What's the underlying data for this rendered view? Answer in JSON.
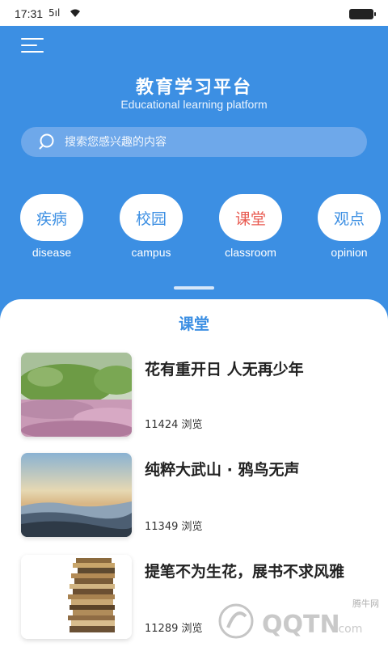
{
  "status_bar": {
    "time": "17:31",
    "signal": "5ıl",
    "icons": [
      "wifi-icon",
      "battery-icon"
    ]
  },
  "header": {
    "menu_icon": "hamburger-menu-icon",
    "title": "教育学习平台",
    "subtitle": "Educational learning platform"
  },
  "search": {
    "placeholder": "搜索您感兴趣的内容",
    "icon": "search-icon"
  },
  "categories": [
    {
      "label_cn": "疾病",
      "label_en": "disease",
      "active": false
    },
    {
      "label_cn": "校园",
      "label_en": "campus",
      "active": false
    },
    {
      "label_cn": "课堂",
      "label_en": "classroom",
      "active": true
    },
    {
      "label_cn": "观点",
      "label_en": "opinion",
      "active": false
    }
  ],
  "section": {
    "title": "课堂"
  },
  "articles": [
    {
      "title": "花有重开日 人无再少年",
      "views": "11424 浏览",
      "image": "flower-field-photo"
    },
    {
      "title": "纯粹大武山 · 鸦鸟无声",
      "views": "11349 浏览",
      "image": "mountain-sunset-photo"
    },
    {
      "title": "提笔不为生花，展书不求风雅",
      "views": "11289 浏览",
      "image": "book-stack-photo"
    }
  ],
  "watermark": {
    "text": "腾牛网",
    "logo": "QQTN.com"
  },
  "colors": {
    "primary": "#3c8fe3",
    "active_category": "#e8594f",
    "search_bg": "#6ea8ea"
  }
}
